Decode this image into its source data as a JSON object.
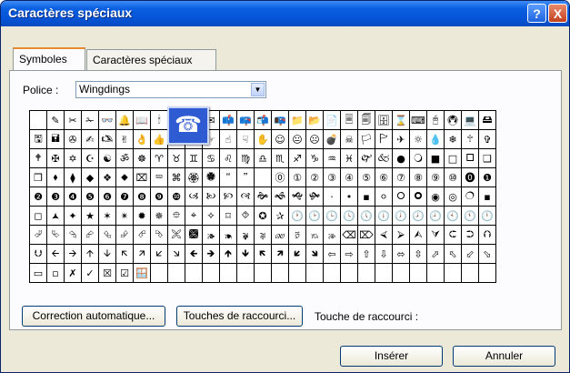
{
  "window": {
    "title": "Caractères spéciaux",
    "help_label": "?",
    "close_label": "X"
  },
  "tabs": [
    {
      "label": "Symboles"
    },
    {
      "label": "Caractères spéciaux"
    }
  ],
  "font": {
    "label": "Police :",
    "value": "Wingdings"
  },
  "symbols": {
    "preview": "☎",
    "rows": [
      [
        " ",
        "✎",
        "✂",
        "✁",
        "👓",
        "🔔",
        "📖",
        "🕯",
        "☎",
        "✆",
        "✉",
        "📫",
        "📪",
        "📬",
        "📭",
        "📁",
        "📂",
        "📄",
        "🗏",
        "🗐",
        "🗄",
        "⌛",
        "⌨",
        "🖰",
        "🖲",
        "💻",
        "🖴"
      ],
      [
        "🖫",
        "🖬",
        "✇",
        "✍",
        "🖎",
        "✌",
        "👌",
        "👍",
        "👎",
        "☜",
        "☞",
        "☝",
        "☟",
        "✋",
        "☺",
        "😐",
        "☹",
        "💣",
        "☠",
        "🏳",
        "🏱",
        "✈",
        "☼",
        "💧",
        "❄",
        "🕆",
        "✞"
      ],
      [
        "🕈",
        "✠",
        "✡",
        "☪",
        "☯",
        "ॐ",
        "☸",
        "♈",
        "♉",
        "♊",
        "♋",
        "♌",
        "♍",
        "♎",
        "♏",
        "♐",
        "♑",
        "♒",
        "♓",
        "🙰",
        "🙵",
        "●",
        "🔾",
        "■",
        "□",
        "🞐",
        "❑"
      ],
      [
        "❒",
        "⬧",
        "⧫",
        "◆",
        "❖",
        "⬥",
        "⌧",
        "⮹",
        "⌘",
        "🏵",
        "🏶",
        "🙶",
        "🙷",
        " ",
        "⓪",
        "①",
        "②",
        "③",
        "④",
        "⑤",
        "⑥",
        "⑦",
        "⑧",
        "⑨",
        "⑩",
        "⓿",
        "❶"
      ],
      [
        "❷",
        "❸",
        "❹",
        "❺",
        "❻",
        "❼",
        "❽",
        "❾",
        "❿",
        "🙢",
        "🙠",
        "🙡",
        "🙣",
        "🙞",
        "🙜",
        "🙝",
        "🙟",
        "·",
        "•",
        "▪",
        "⚪",
        "🞆",
        "🞈",
        "◉",
        "◎",
        "🔿",
        "▪"
      ],
      [
        "◻",
        "🟂",
        "✦",
        "★",
        "✶",
        "✴",
        "✹",
        "✵",
        "⯐",
        "⌖",
        "⟡",
        "⌑",
        "⯑",
        "✪",
        "✰",
        "🕐",
        "🕑",
        "🕒",
        "🕓",
        "🕔",
        "🕕",
        "🕖",
        "🕗",
        "🕘",
        "🕙",
        "🕚",
        "🕛"
      ],
      [
        "⮰",
        "⮱",
        "⮲",
        "⮳",
        "⮴",
        "⮵",
        "⮶",
        "⮷",
        "🙪",
        "🙫",
        "🙕",
        "🙔",
        "🙗",
        "🙖",
        "🙐",
        "🙑",
        "🙒",
        "🙓",
        "⌫",
        "⌦",
        "⮘",
        "⮚",
        "⮙",
        "⮛",
        "⮈",
        "⮊",
        "⮉"
      ],
      [
        "⮋",
        "🡨",
        "🡪",
        "🡩",
        "🡫",
        "🡬",
        "🡭",
        "🡯",
        "🡮",
        "🡸",
        "🡺",
        "🡹",
        "🡻",
        "🡼",
        "🡽",
        "🡿",
        "🡾",
        "⇦",
        "⇨",
        "⇧",
        "⇩",
        "⬄",
        "⇳",
        "⬀",
        "⬁",
        "⬃",
        "⬂"
      ],
      [
        "▭",
        "▫",
        "✗",
        "✓",
        "☒",
        "☑",
        "🪟",
        " ",
        " ",
        " ",
        " ",
        " ",
        " ",
        " ",
        " ",
        " ",
        " ",
        " ",
        " ",
        " ",
        " ",
        " ",
        " ",
        " ",
        " ",
        " ",
        " "
      ]
    ]
  },
  "buttons": {
    "autocorrect": "Correction automatique...",
    "shortcut": "Touches de raccourci...",
    "insert": "Insérer",
    "cancel": "Annuler"
  },
  "shortcut_label": "Touche de raccourci :"
}
